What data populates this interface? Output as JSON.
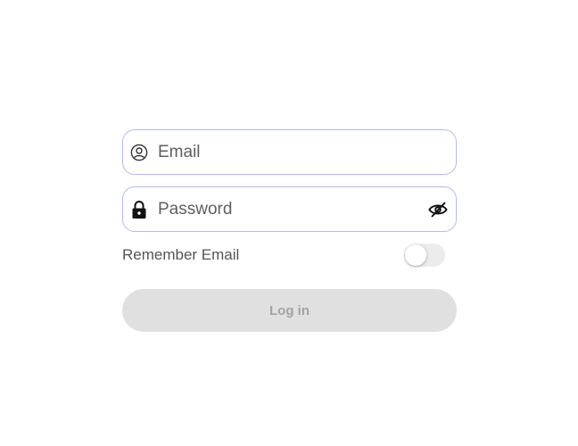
{
  "login_form": {
    "email": {
      "placeholder": "Email",
      "value": "",
      "icon": "user-circle-icon"
    },
    "password": {
      "placeholder": "Password",
      "value": "",
      "icon": "lock-icon",
      "visibility_icon": "eye-slash-icon"
    },
    "remember_email": {
      "label": "Remember Email",
      "enabled": false
    },
    "login_button": {
      "label": "Log in",
      "disabled": true
    }
  },
  "colors": {
    "field_border": "#b6b9ec",
    "button_background": "#e0e0e0",
    "button_text": "#a3a3a3",
    "toggle_track": "#ececec"
  }
}
